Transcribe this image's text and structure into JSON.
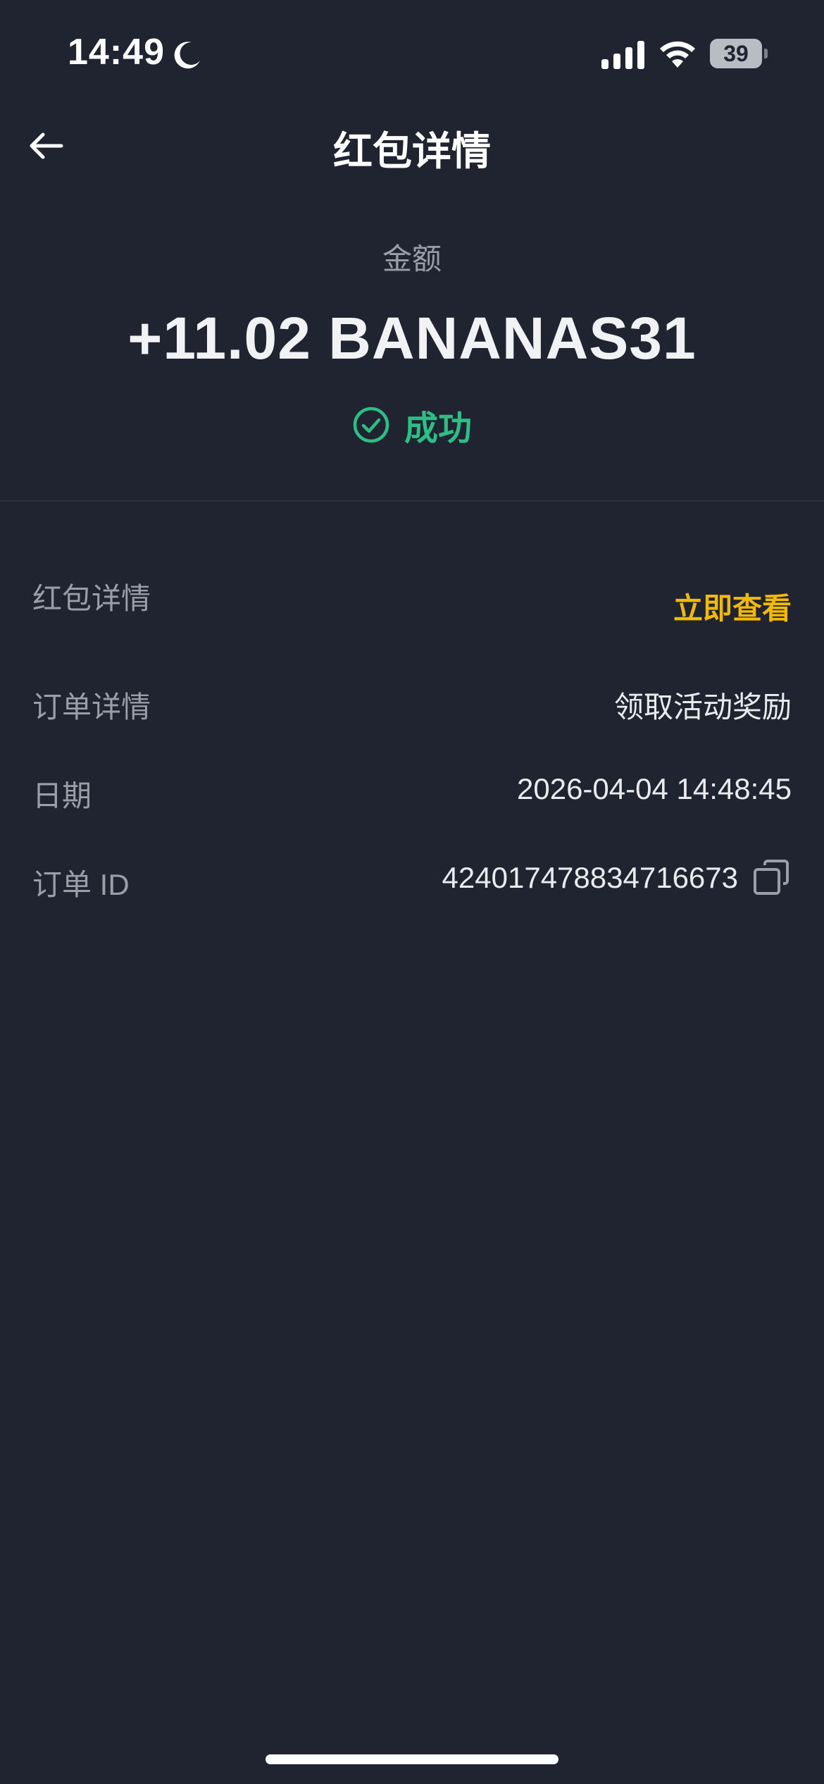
{
  "status_bar": {
    "time": "14:49",
    "battery": "39",
    "icons": [
      "moon-icon",
      "signal-icon",
      "wifi-icon",
      "battery-icon"
    ]
  },
  "header": {
    "title": "红包详情",
    "back_icon": "arrow-left-icon"
  },
  "summary": {
    "amount_label": "金额",
    "amount": "+11.02 BANANAS31",
    "status": "成功",
    "status_icon": "check-circle-icon",
    "status_color": "#2ebd85"
  },
  "details": {
    "redpacket": {
      "label": "红包详情",
      "value": "立即查看",
      "value_color": "#f0b90b"
    },
    "order_details": {
      "label": "订单详情",
      "value": "领取活动奖励"
    },
    "date": {
      "label": "日期",
      "value": "2026-04-04 14:48:45"
    },
    "order_id": {
      "label": "订单 ID",
      "value": "424017478834716673",
      "copy_icon": "copy-icon"
    }
  },
  "colors": {
    "background": "#1f2430",
    "accent": "#f0b90b",
    "success": "#2ebd85"
  }
}
